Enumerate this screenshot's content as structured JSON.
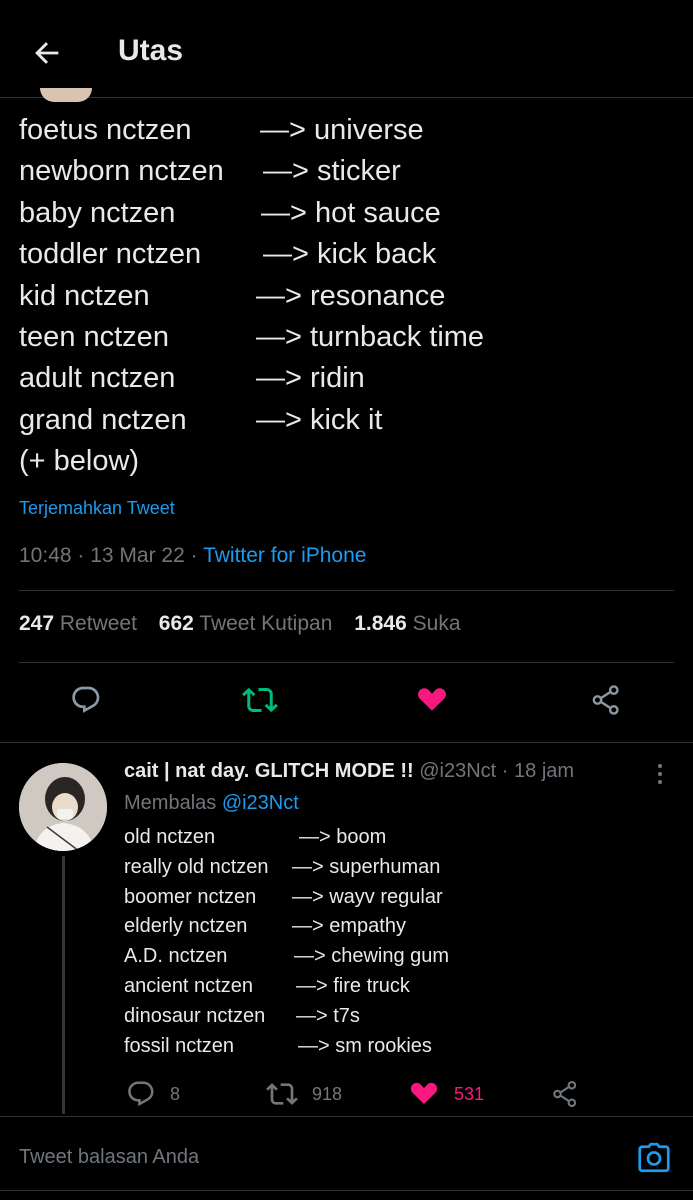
{
  "header": {
    "title": "Utas",
    "back_icon": "arrow-left-icon"
  },
  "tweet": {
    "lines": [
      {
        "left": "foetus nctzen",
        "right": "—> universe"
      },
      {
        "left": "newborn nctzen",
        "right": "—> sticker"
      },
      {
        "left": "baby nctzen",
        "right": "—> hot sauce"
      },
      {
        "left": "toddler nctzen",
        "right": "—> kick back"
      },
      {
        "left": "kid nctzen",
        "right": "—> resonance"
      },
      {
        "left": "teen nctzen",
        "right": "—> turnback time"
      },
      {
        "left": "adult nctzen",
        "right": "—> ridin"
      },
      {
        "left": "grand nctzen",
        "right": "—> kick it"
      }
    ],
    "below": "(+ below)",
    "translate": "Terjemahkan Tweet",
    "time": "10:48 · 13 Mar 22 · ",
    "source": "Twitter for iPhone",
    "stats": {
      "retweets": "247",
      "retweets_label": "Retweet",
      "quotes": "662",
      "quotes_label": "Tweet Kutipan",
      "likes": "1.846",
      "likes_label": "Suka"
    },
    "actions": {
      "reply_icon": "reply-icon",
      "retweet_icon": "retweet-icon",
      "like_icon": "heart-icon",
      "share_icon": "share-icon",
      "retweet_color": "#00ba7c",
      "like_color": "#f91880"
    }
  },
  "reply": {
    "name": "cait | nat day. GLITCH MODE !!",
    "meta": " @i23Nct · 18 jam",
    "replying_label": "Membalas ",
    "replying_to": "@i23Nct",
    "lines": [
      {
        "left": "old nctzen",
        "right": "—> boom"
      },
      {
        "left": "really old nctzen",
        "right": "—> superhuman"
      },
      {
        "left": "boomer nctzen",
        "right": "—> wayv regular"
      },
      {
        "left": "elderly nctzen",
        "right": "—> empathy"
      },
      {
        "left": "A.D. nctzen",
        "right": "—> chewing gum"
      },
      {
        "left": "ancient nctzen",
        "right": "—> fire truck"
      },
      {
        "left": "dinosaur nctzen",
        "right": "—> t7s"
      },
      {
        "left": "fossil nctzen",
        "right": "—> sm rookies"
      }
    ],
    "reply_count": "8",
    "retweet_count": "918",
    "like_count": "531"
  },
  "composer": {
    "placeholder": "Tweet balasan Anda",
    "camera_icon": "camera-icon"
  },
  "colors": {
    "background": "#000000",
    "accent": "#1d9bf0",
    "muted": "#71767b",
    "divider": "#2f3336"
  }
}
